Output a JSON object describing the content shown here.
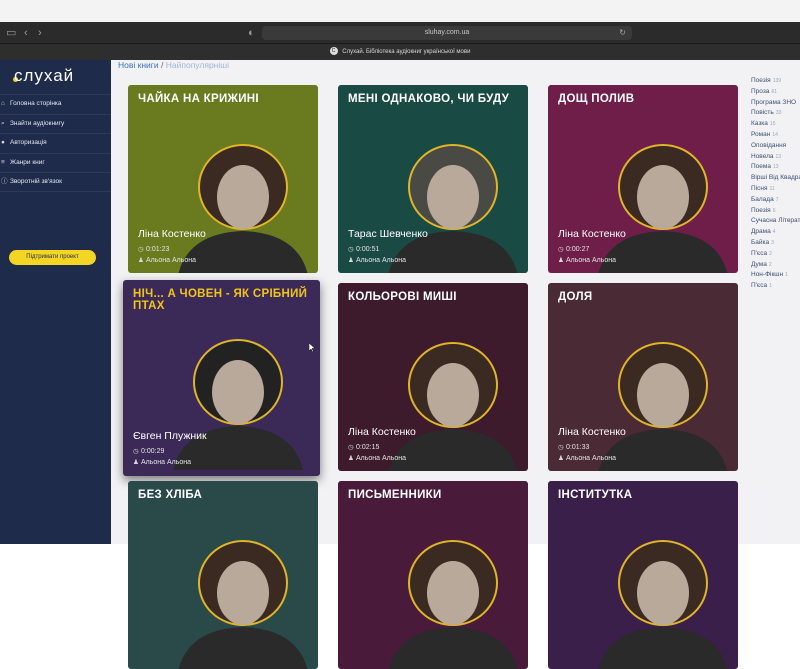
{
  "browser": {
    "url": "sluhay.com.ua",
    "tab_title": "Слухай. Бібліотека аудіокниг української мови",
    "tab_favicon": "C"
  },
  "sidebar": {
    "logo": "слухай",
    "items": [
      {
        "label": "Головна сторінка",
        "icon": "home-icon"
      },
      {
        "label": "Знайти аудіокнигу",
        "icon": "search-icon"
      },
      {
        "label": "Авторизація",
        "icon": "user-icon"
      },
      {
        "label": "Жанри книг",
        "icon": "genres-icon"
      },
      {
        "label": "Зворотній зв'язок",
        "icon": "info-icon"
      }
    ],
    "support_button": "Підтримати проект"
  },
  "breadcrumb": {
    "current": "Нові книги",
    "separator": "/",
    "next": "Найпопулярніші"
  },
  "books": [
    {
      "title": "ЧАЙКА НА КРИЖИНІ",
      "author": "Ліна Костенко",
      "duration": "0:01:23",
      "narrator": "Альона Альона",
      "bg": "#6a7a1f"
    },
    {
      "title": "МЕНІ ОДНАКОВО, ЧИ БУДУ",
      "author": "Тарас Шевченко",
      "duration": "0:00:51",
      "narrator": "Альона Альона",
      "bg": "#1a4a44"
    },
    {
      "title": "ДОЩ ПОЛИВ",
      "author": "Ліна Костенко",
      "duration": "0:00:27",
      "narrator": "Альона Альона",
      "bg": "#6e1e48"
    },
    {
      "title": "НІЧ... А ЧОВЕН - ЯК СРІБНИЙ ПТАХ",
      "author": "Євген Плужник",
      "duration": "0:00:29",
      "narrator": "Альона Альона",
      "bg": "#3b2a58"
    },
    {
      "title": "КОЛЬОРОВІ МИШІ",
      "author": "Ліна Костенко",
      "duration": "0:02:15",
      "narrator": "Альона Альона",
      "bg": "#3d1a2c"
    },
    {
      "title": "ДОЛЯ",
      "author": "Ліна Костенко",
      "duration": "0:01:33",
      "narrator": "Альона Альона",
      "bg": "#4a2a34"
    },
    {
      "title": "БЕЗ ХЛІБА",
      "author": "",
      "duration": "",
      "narrator": "",
      "bg": "#2a4a4a"
    },
    {
      "title": "ПИСЬМЕННИКИ",
      "author": "",
      "duration": "",
      "narrator": "",
      "bg": "#4a1a3a"
    },
    {
      "title": "ІНСТИТУТКА",
      "author": "",
      "duration": "",
      "narrator": "",
      "bg": "#3a1f4a"
    }
  ],
  "genres": [
    {
      "name": "Поезія",
      "count": "139"
    },
    {
      "name": "Проза",
      "count": "61"
    },
    {
      "name": "Програма ЗНО",
      "count": ""
    },
    {
      "name": "Повість",
      "count": "33"
    },
    {
      "name": "Казка",
      "count": "15"
    },
    {
      "name": "Роман",
      "count": "14"
    },
    {
      "name": "Оповідання",
      "count": ""
    },
    {
      "name": "Новела",
      "count": "13"
    },
    {
      "name": "Поема",
      "count": "13"
    },
    {
      "name": "Вірші Від Квадрата",
      "count": ""
    },
    {
      "name": "Пісня",
      "count": "11"
    },
    {
      "name": "Балада",
      "count": "7"
    },
    {
      "name": "Поезія",
      "count": "6"
    },
    {
      "name": "Сучасна Література",
      "count": ""
    },
    {
      "name": "Драма",
      "count": "4"
    },
    {
      "name": "Байка",
      "count": "3"
    },
    {
      "name": "П'єса",
      "count": "2"
    },
    {
      "name": "Дума",
      "count": "2"
    },
    {
      "name": "Нон-Фікшн",
      "count": "1"
    },
    {
      "name": "П'єса",
      "count": "1"
    }
  ],
  "colors": {
    "sidebar": "#1f2b4a",
    "accent": "#f5d524",
    "link": "#3b72c6"
  }
}
